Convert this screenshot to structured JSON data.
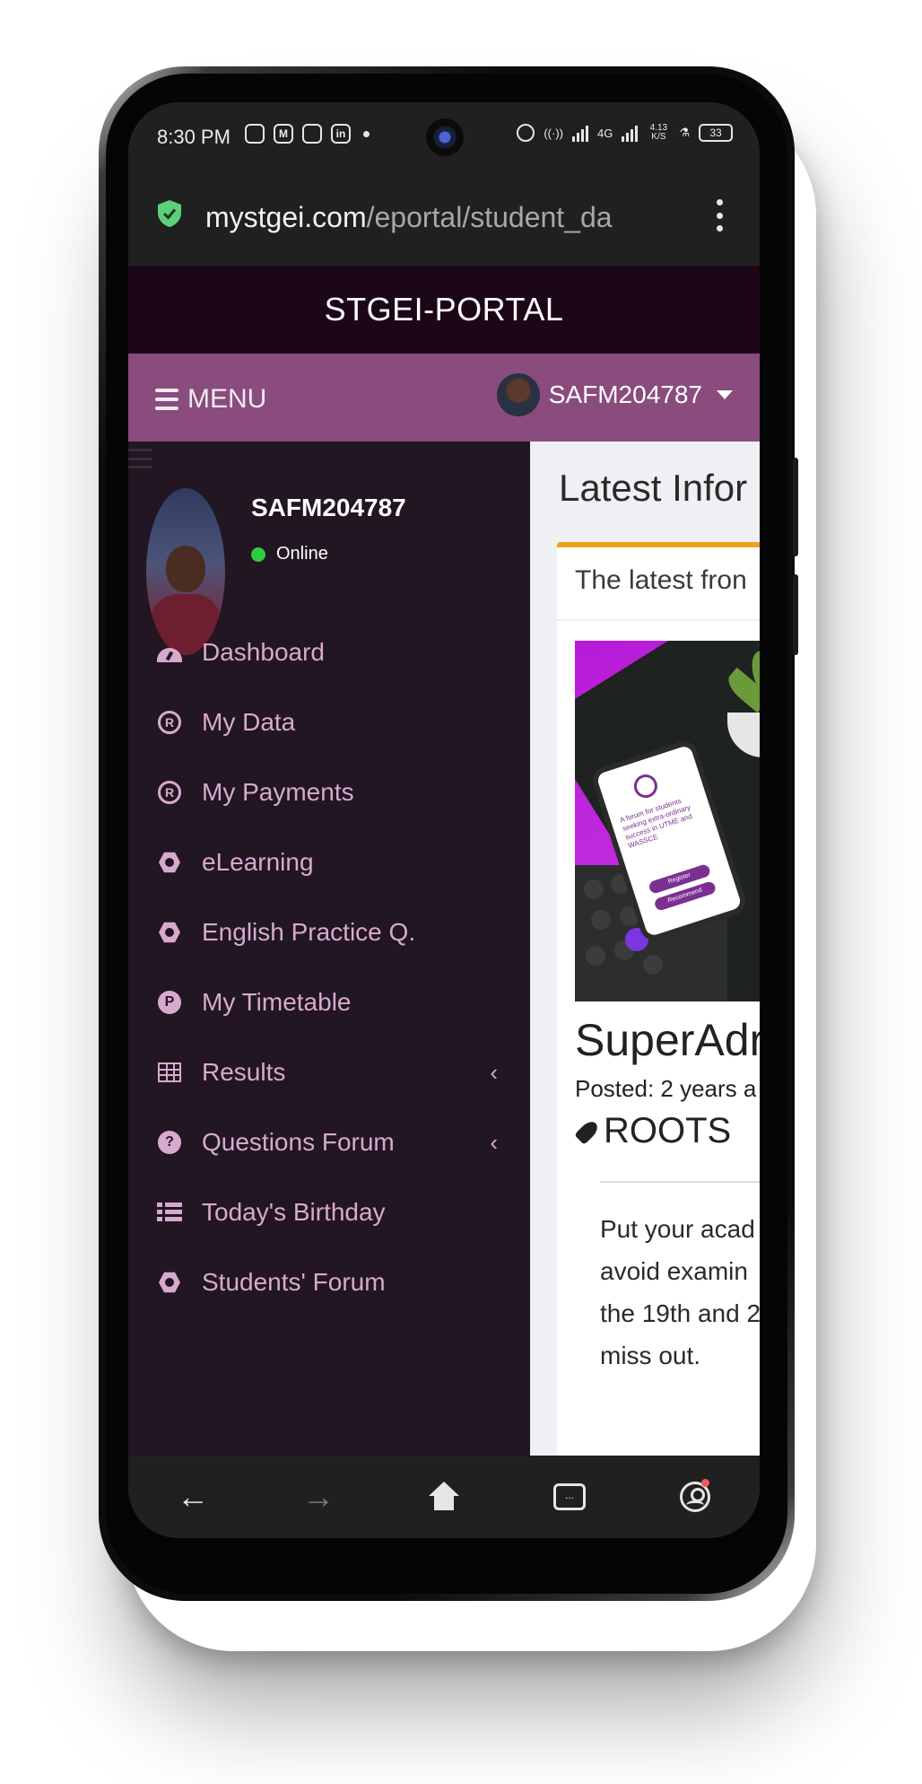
{
  "status_bar": {
    "time": "8:30 PM",
    "network_label": "4G",
    "speed_label": "4.13 K/S",
    "battery": "33"
  },
  "browser": {
    "url_domain": "mystgei.com",
    "url_path": "/eportal/student_da",
    "icons": [
      "shield-check-icon",
      "more-vert-icon"
    ]
  },
  "site": {
    "title_bold": "STGEI",
    "title_rest": "-PORTAL",
    "menu_label": "MENU",
    "user_id": "SAFM204787",
    "colors": {
      "header": "#1b0717",
      "nav": "#8a4c7d",
      "sidebar": "#211621",
      "accent": "#f0a020",
      "online": "#2ecc40"
    }
  },
  "sidebar": {
    "profile_name": "SAFM204787",
    "status": "Online",
    "items": [
      {
        "label": "Dashboard",
        "icon": "gauge-icon",
        "has_submenu": false
      },
      {
        "label": "My Data",
        "icon": "registered-icon",
        "has_submenu": false
      },
      {
        "label": "My Payments",
        "icon": "registered-icon",
        "has_submenu": false
      },
      {
        "label": "eLearning",
        "icon": "hex-gear-icon",
        "has_submenu": false
      },
      {
        "label": "English Practice Q.",
        "icon": "hex-gear-icon",
        "has_submenu": false
      },
      {
        "label": "My Timetable",
        "icon": "p-circle-icon",
        "has_submenu": false
      },
      {
        "label": "Results",
        "icon": "table-icon",
        "has_submenu": true,
        "chevron": "‹"
      },
      {
        "label": "Questions Forum",
        "icon": "question-circle-icon",
        "has_submenu": true,
        "chevron": "‹"
      },
      {
        "label": "Today's Birthday",
        "icon": "list-icon",
        "has_submenu": false
      },
      {
        "label": "Students' Forum",
        "icon": "hex-gear-icon",
        "has_submenu": false
      }
    ]
  },
  "main": {
    "title": "Latest Infor",
    "card_subtitle": "The latest fron",
    "post": {
      "image_text": "A forum for students seeking extra-ordinary success in UTME and WASSCE",
      "image_button_1": "Register",
      "image_button_2": "Recommend",
      "title": "SuperAdr",
      "posted": "Posted: 2 years a",
      "tag": "ROOTS",
      "body_lines": [
        "Put your acad",
        "avoid examin",
        "the 19th and 2",
        "miss out."
      ]
    }
  },
  "bottom_nav": {
    "back": "←",
    "forward": "→",
    "tabs_label": "...",
    "icons": [
      "back-arrow-icon",
      "forward-arrow-icon",
      "home-icon",
      "tabs-icon",
      "account-icon"
    ]
  }
}
